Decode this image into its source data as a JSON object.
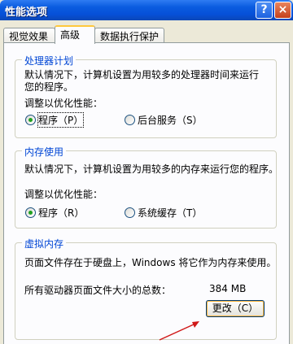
{
  "window": {
    "title": "性能选项"
  },
  "tabs": [
    {
      "label": "视觉效果"
    },
    {
      "label": "高级"
    },
    {
      "label": "数据执行保护"
    }
  ],
  "processor": {
    "legend": "处理器计划",
    "desc1": "默认情况下，计算机设置为用较多的处理器时间来运行",
    "desc2": "您的程序。",
    "adjust": "调整以优化性能：",
    "opt_programs": "程序（P）",
    "opt_services": "后台服务（S）",
    "selected": "programs"
  },
  "memory": {
    "legend": "内存使用",
    "desc": "默认情况下，计算机设置为用较多的内存来运行您的程序。",
    "adjust": "调整以优化性能：",
    "opt_programs": "程序（R）",
    "opt_cache": "系统缓存（T）",
    "selected": "programs"
  },
  "virtual_memory": {
    "legend": "虚拟内存",
    "desc": "页面文件存在于硬盘上，Windows 将它作为内存来使用。",
    "total_label": "所有驱动器页面文件大小的总数：",
    "total_value": "384 MB",
    "change_button": "更改（C）"
  }
}
